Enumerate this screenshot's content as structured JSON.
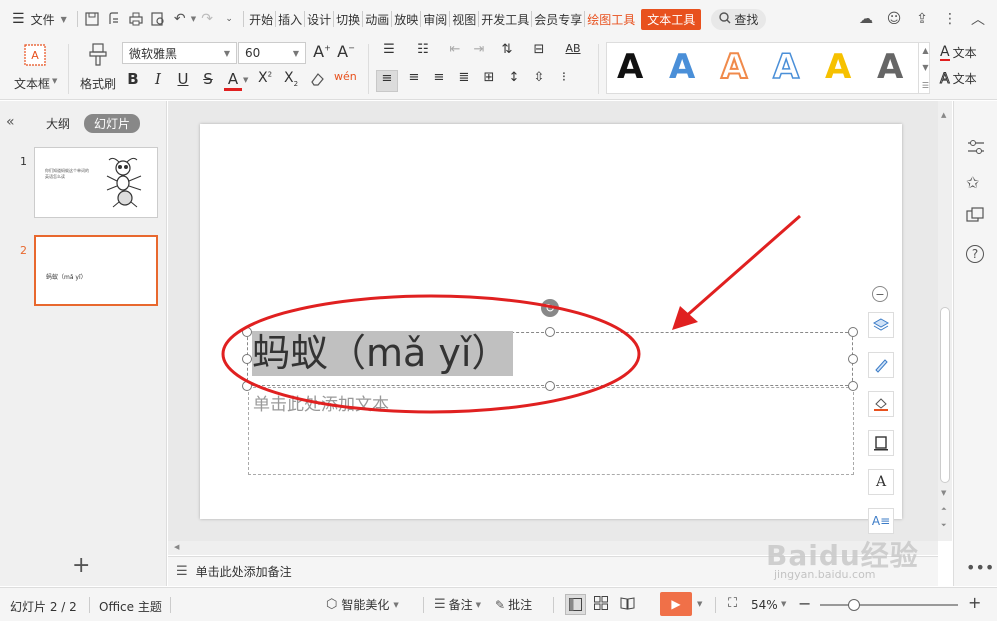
{
  "menubar": {
    "file_label": "文件",
    "tabs": [
      "开始",
      "插入",
      "设计",
      "切换",
      "动画",
      "放映",
      "审阅",
      "视图",
      "开发工具",
      "会员专享"
    ],
    "context_tab_1": "绘图工具",
    "context_tab_2": "文本工具",
    "search_label": "查找"
  },
  "ribbon": {
    "textbox_label": "文本框",
    "format_painter_label": "格式刷",
    "font_name": "微软雅黑",
    "font_size": "60",
    "right_label_1": "文本",
    "right_label_2": "文本",
    "gallery_letter": "A"
  },
  "left_panel": {
    "outline_tab": "大纲",
    "slides_tab": "幻灯片",
    "thumb1_number": "1",
    "thumb1_text": "你们知道蚂蚁这个单词的英语怎么读",
    "thumb2_number": "2",
    "thumb2_text": "蚂蚁（mǎ yǐ）",
    "add_icon": "+"
  },
  "slide": {
    "title_text": "蚂蚁（mǎ yǐ）",
    "subtitle_placeholder": "单击此处添加文本"
  },
  "notes": {
    "placeholder": "单击此处添加备注"
  },
  "statusbar": {
    "slide_index": "幻灯片 2 / 2",
    "theme": "Office 主题",
    "beautify": "智能美化",
    "notes_label": "备注",
    "comments_label": "批注",
    "zoom": "54%"
  },
  "watermark": {
    "brand": "Baidu经验",
    "url": "jingyan.baidu.com"
  },
  "colors": {
    "accent": "#e8511e",
    "annotation_red": "#e02020",
    "title_highlight": "#c0c0c0"
  }
}
